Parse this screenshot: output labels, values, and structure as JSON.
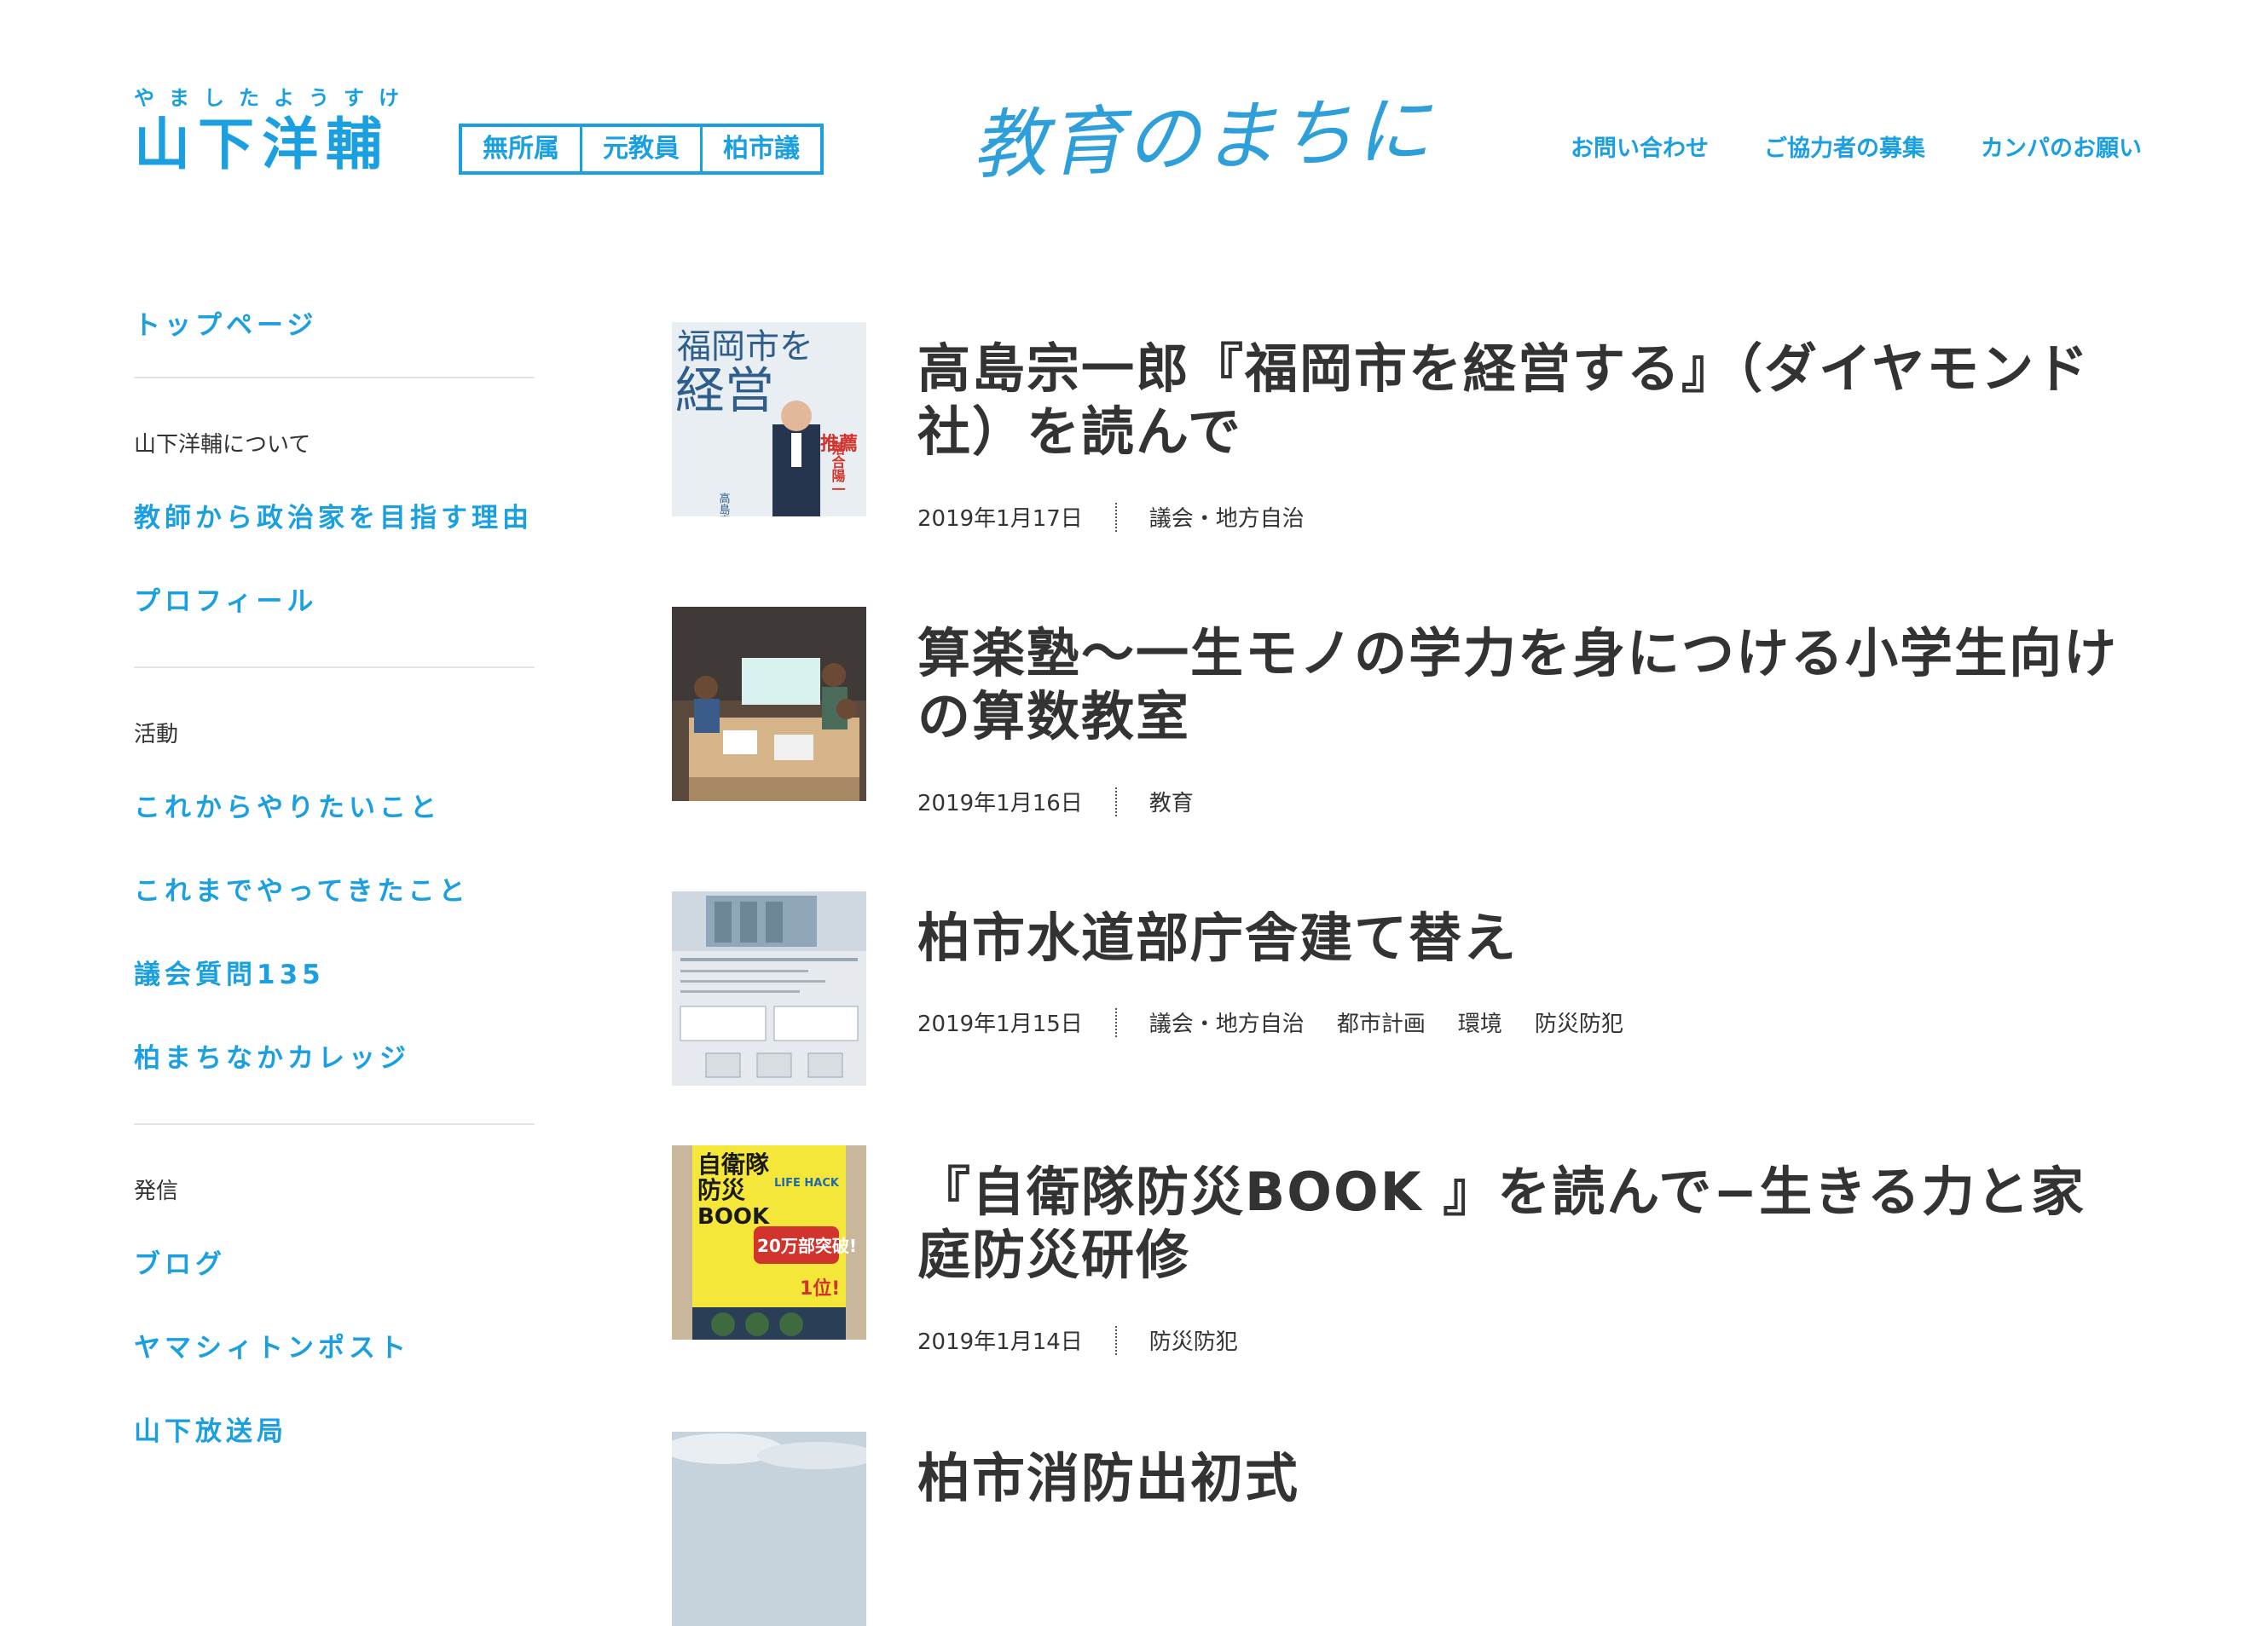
{
  "header": {
    "kana": "やましたようすけ",
    "name": "山下洋輔",
    "tags": [
      "無所属",
      "元教員",
      "柏市議"
    ],
    "slogan": "教育のまちに",
    "nav": [
      "お問い合わせ",
      "ご協力者の募集",
      "カンパのお願い"
    ]
  },
  "sidebar": {
    "top_link": "トップページ",
    "section_about": "山下洋輔について",
    "about_links": [
      "教師から政治家を目指す理由",
      "プロフィール"
    ],
    "section_activity": "活動",
    "activity_links": [
      "これからやりたいこと",
      "これまでやってきたこと",
      "議会質問135",
      "柏まちなかカレッジ"
    ],
    "section_publish": "発信",
    "publish_links": [
      "ブログ",
      "ヤマシィトンポスト",
      "山下放送局"
    ]
  },
  "articles": [
    {
      "title": "高島宗一郎『福岡市を経営する』（ダイヤモンド社）を読んで",
      "date": "2019年1月17日",
      "categories": [
        "議会・地方自治"
      ],
      "thumb_text": [
        "福岡市を",
        "経営",
        "推薦",
        "落合陽一",
        "高島宗一郎"
      ]
    },
    {
      "title": "算楽塾〜一生モノの学力を身につける小学生向けの算数教室",
      "date": "2019年1月16日",
      "categories": [
        "教育"
      ]
    },
    {
      "title": "柏市水道部庁舎建て替え",
      "date": "2019年1月15日",
      "categories": [
        "議会・地方自治",
        "都市計画",
        "環境",
        "防災防犯"
      ]
    },
    {
      "title": "『自衛隊防災BOOK 』を読んで−生きる力と家庭防災研修",
      "date": "2019年1月14日",
      "categories": [
        "防災防犯"
      ],
      "thumb_text": [
        "自衛隊",
        "防災",
        "BOOK",
        "20万部突破!",
        "1位!",
        "LIFE HACK"
      ]
    },
    {
      "title": "柏市消防出初式",
      "date": "",
      "categories": []
    }
  ]
}
